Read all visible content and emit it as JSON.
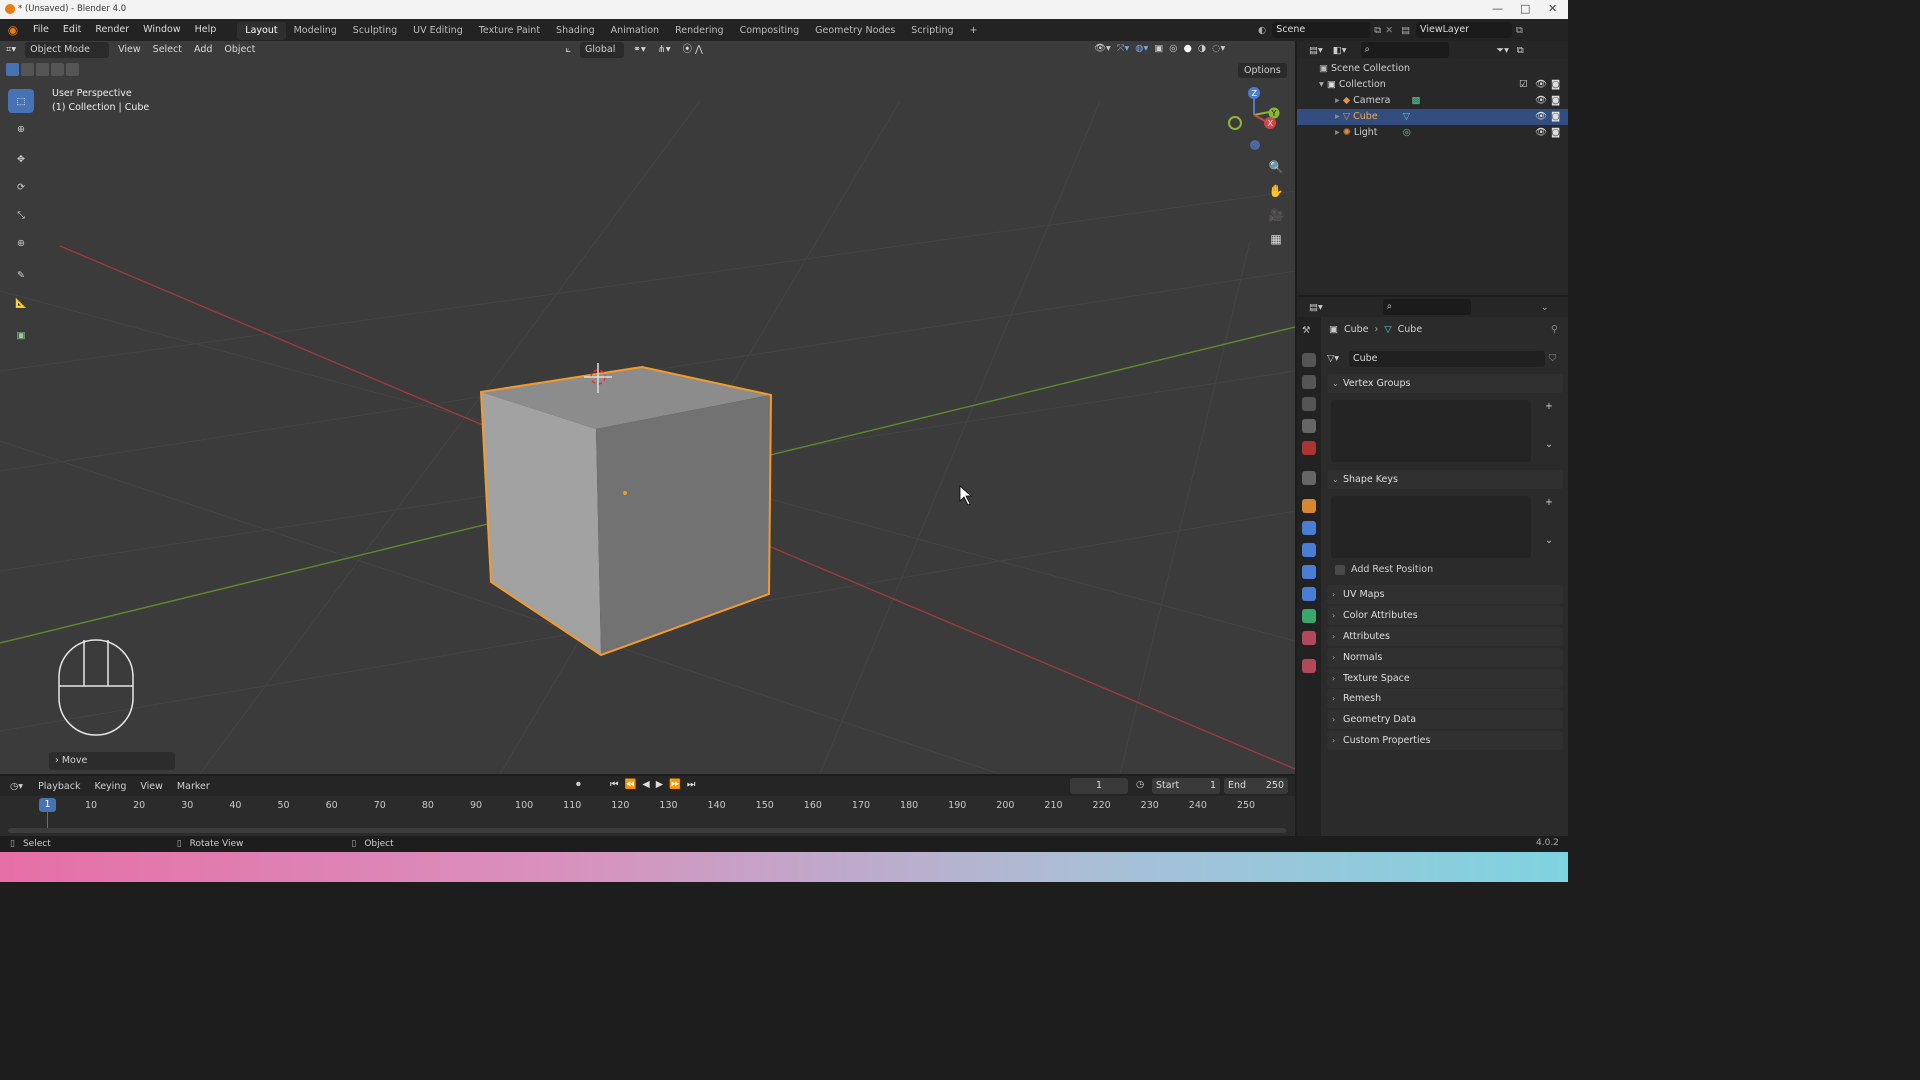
{
  "window": {
    "title": "* (Unsaved) - Blender 4.0"
  },
  "menu": [
    "File",
    "Edit",
    "Render",
    "Window",
    "Help"
  ],
  "workspaces": [
    "Layout",
    "Modeling",
    "Sculpting",
    "UV Editing",
    "Texture Paint",
    "Shading",
    "Animation",
    "Rendering",
    "Compositing",
    "Geometry Nodes",
    "Scripting"
  ],
  "active_workspace": "Layout",
  "scene": {
    "label": "Scene",
    "view_layer": "ViewLayer"
  },
  "viewport_header": {
    "mode": "Object Mode",
    "menus": [
      "View",
      "Select",
      "Add",
      "Object"
    ],
    "orientation": "Global",
    "options": "Options"
  },
  "viewport": {
    "perspective": "User Perspective",
    "collection": "(1) Collection | Cube",
    "last_op": "Move"
  },
  "gizmo": {
    "z": "Z",
    "y": "Y",
    "x": "X"
  },
  "outliner": {
    "root": "Scene Collection",
    "collection": "Collection",
    "items": [
      {
        "name": "Camera",
        "selected": false
      },
      {
        "name": "Cube",
        "selected": true
      },
      {
        "name": "Light",
        "selected": false
      }
    ]
  },
  "properties": {
    "breadcrumb_object": "Cube",
    "breadcrumb_data": "Cube",
    "data_name": "Cube",
    "panels_open": [
      "Vertex Groups",
      "Shape Keys"
    ],
    "add_rest_position": "Add Rest Position",
    "panels_closed": [
      "UV Maps",
      "Color Attributes",
      "Attributes",
      "Normals",
      "Texture Space",
      "Remesh",
      "Geometry Data",
      "Custom Properties"
    ]
  },
  "timeline": {
    "menus": [
      "Playback",
      "Keying",
      "View",
      "Marker"
    ],
    "current_frame": "1",
    "start_label": "Start",
    "start": "1",
    "end_label": "End",
    "end": "250",
    "ticks": [
      "1",
      "10",
      "20",
      "30",
      "40",
      "50",
      "60",
      "70",
      "80",
      "90",
      "100",
      "110",
      "120",
      "130",
      "140",
      "150",
      "160",
      "170",
      "180",
      "190",
      "200",
      "210",
      "220",
      "230",
      "240",
      "250"
    ]
  },
  "statusbar": {
    "select": "Select",
    "rotate": "Rotate View",
    "object": "Object",
    "version": "4.0.2"
  },
  "colors": {
    "accent": "#4772b3",
    "selection": "#e8902d",
    "background": "#3b3b3b"
  }
}
